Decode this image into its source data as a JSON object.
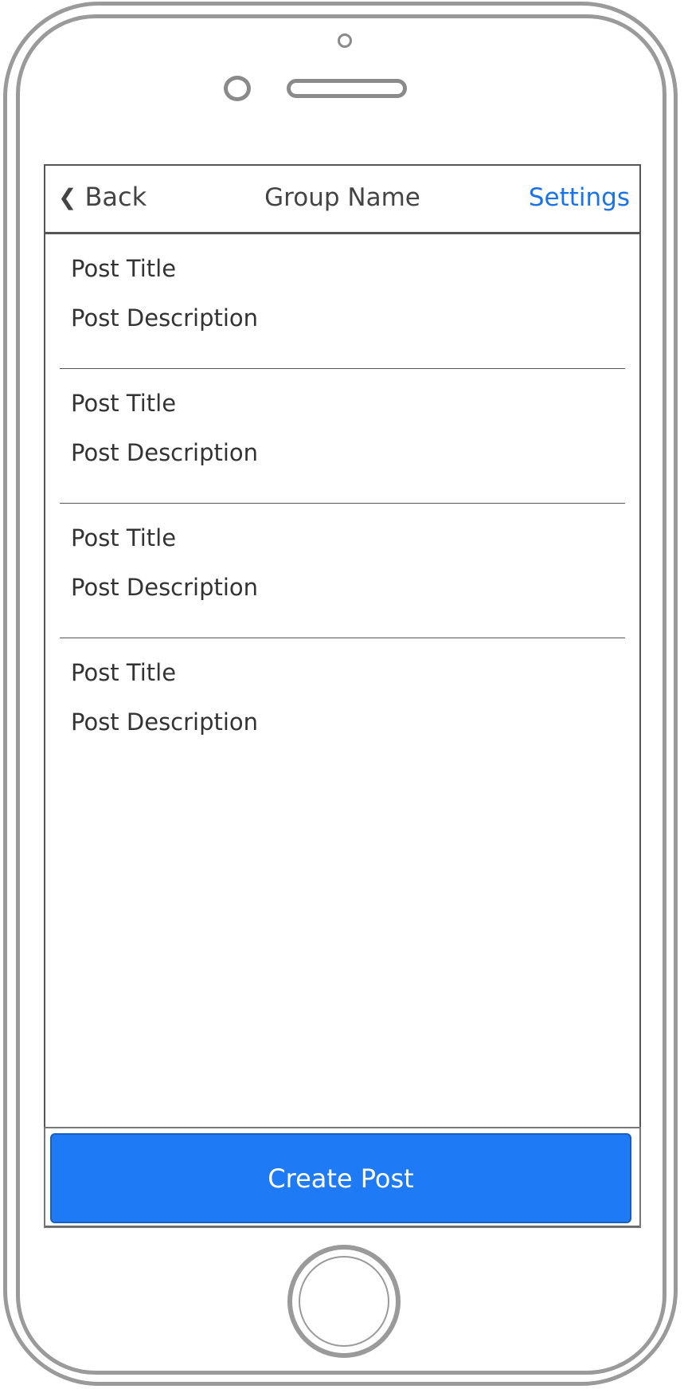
{
  "navbar": {
    "back_label": "Back",
    "title": "Group Name",
    "settings_label": "Settings"
  },
  "posts": [
    {
      "title": "Post Title",
      "description": "Post Description"
    },
    {
      "title": "Post Title",
      "description": "Post Description"
    },
    {
      "title": "Post Title",
      "description": "Post Description"
    },
    {
      "title": "Post Title",
      "description": "Post Description"
    }
  ],
  "actions": {
    "create_post_label": "Create Post"
  },
  "colors": {
    "accent": "#1f7af5",
    "text": "#333333",
    "frame": "#9a9a9a"
  }
}
